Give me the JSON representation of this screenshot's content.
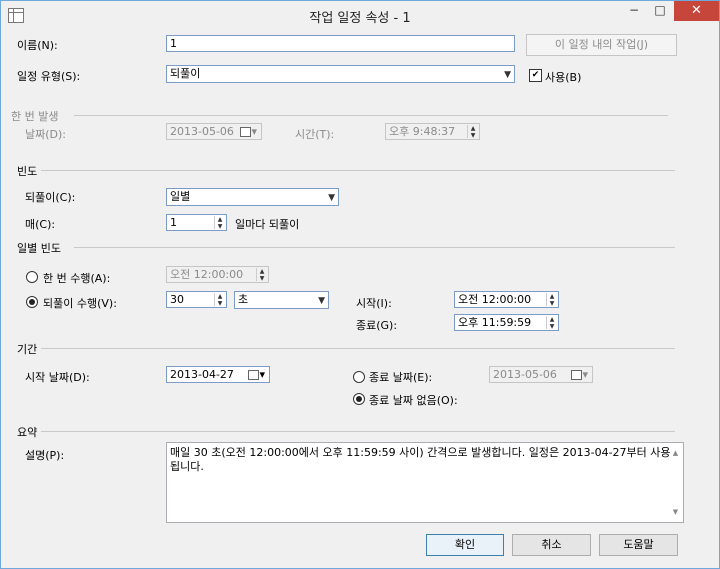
{
  "window": {
    "title": "작업 일정 속성 - 1",
    "controls": {
      "minimize": "−",
      "maximize": "□",
      "close": "✕"
    }
  },
  "name": {
    "label": "이름(N):",
    "value": "1",
    "button": "이 일정 내의 작업(J)"
  },
  "schedule_type": {
    "label": "일정 유형(S):",
    "value": "되풀이",
    "enable_label": "사용(B)",
    "enabled": true
  },
  "once": {
    "section": "한 번 발생",
    "date_label": "날짜(D):",
    "date_value": "2013-05-06",
    "time_label": "시간(T):",
    "time_value": "오후  9:48:37"
  },
  "frequency": {
    "section": "빈도",
    "occurs_label": "되풀이(C):",
    "occurs_value": "일별",
    "every_label": "매(C):",
    "every_value": "1",
    "every_suffix": "일마다 되풀이"
  },
  "daily": {
    "section": "일별 빈도",
    "once_label": "한 번 수행(A):",
    "once_time": "오전 12:00:00",
    "every_label": "되풀이 수행(V):",
    "every_value": "30",
    "unit_value": "초",
    "start_label": "시작(I):",
    "start_time": "오전 12:00:00",
    "end_label": "종료(G):",
    "end_time": "오후 11:59:59",
    "selected": "every"
  },
  "duration": {
    "section": "기간",
    "start_label": "시작 날짜(D):",
    "start_date": "2013-04-27",
    "end_date_label": "종료 날짜(E):",
    "end_date": "2013-05-06",
    "no_end_label": "종료 날짜 없음(O):",
    "selected": "no_end"
  },
  "summary": {
    "section": "요약",
    "desc_label": "설명(P):",
    "text": "매일 30 초(오전 12:00:00에서 오후 11:59:59 사이) 간격으로 발생합니다. 일정은 2013-04-27부터 사용됩니다."
  },
  "buttons": {
    "ok": "확인",
    "cancel": "취소",
    "help": "도움말"
  },
  "colors": {
    "close_button": "#c7463b",
    "focus_border": "#7a9cc6",
    "disabled_text": "#8a8a8a"
  }
}
